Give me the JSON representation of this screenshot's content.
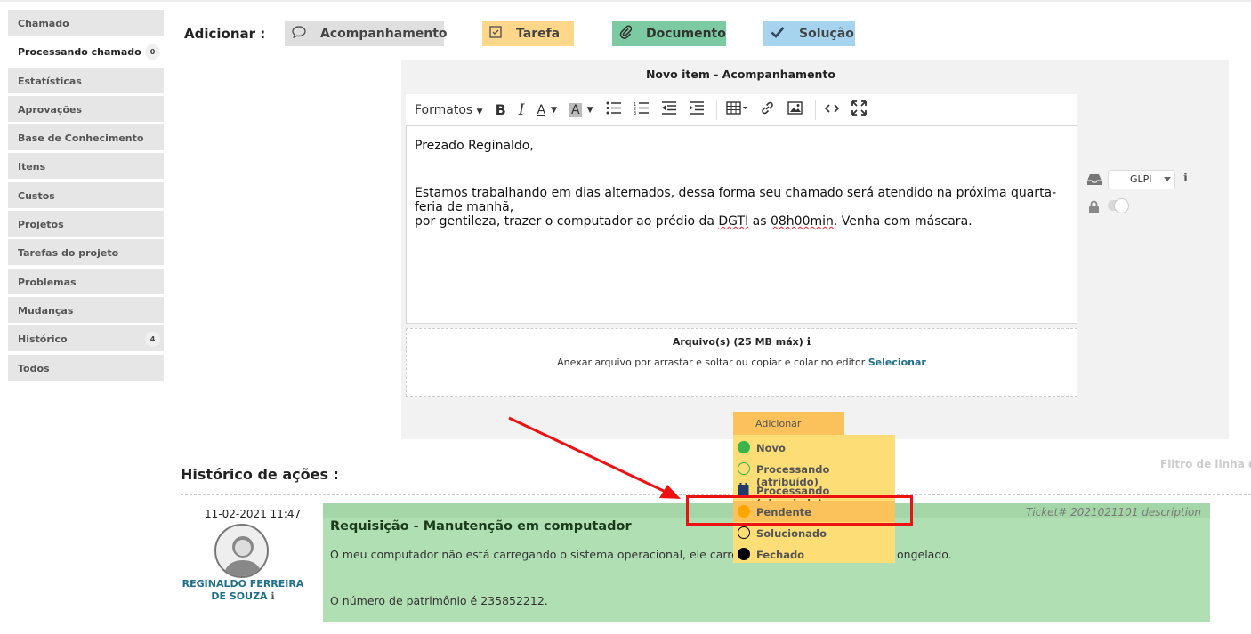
{
  "sidebar": {
    "items": [
      {
        "label": "Chamado"
      },
      {
        "label": "Processando chamado",
        "badge": "0",
        "active": true
      },
      {
        "label": "Estatísticas"
      },
      {
        "label": "Aprovações"
      },
      {
        "label": "Base de Conhecimento"
      },
      {
        "label": "Itens"
      },
      {
        "label": "Custos"
      },
      {
        "label": "Projetos"
      },
      {
        "label": "Tarefas do projeto"
      },
      {
        "label": "Problemas"
      },
      {
        "label": "Mudanças"
      },
      {
        "label": "Histórico",
        "badge": "4"
      },
      {
        "label": "Todos"
      }
    ]
  },
  "addbar": {
    "label": "Adicionar :",
    "acompanhamento": "Acompanhamento",
    "tarefa": "Tarefa",
    "documento": "Documento",
    "solucao": "Solução"
  },
  "editor": {
    "title": "Novo item - Acompanhamento",
    "formatos": "Formatos",
    "greeting": "Prezado Reginaldo,",
    "body_1": "Estamos trabalhando em dias alternados, dessa forma seu chamado será atendido na próxima quarta-feria de manhã,",
    "body_2a": "por gentileza, trazer o computador ao prédio da ",
    "body_2b": "DGTI",
    "body_2c": " as ",
    "body_2d": "08h00min",
    "body_2e": ". Venha com máscara."
  },
  "files": {
    "title": "Arquivo(s) (25 MB máx)",
    "hint": "Anexar arquivo por arrastar e soltar ou copiar e colar no editor ",
    "link": "Selecionar"
  },
  "side_ctrls": {
    "source": "GLPI"
  },
  "dropdown": {
    "header": "Adicionar",
    "options": [
      {
        "label": "Novo",
        "color": "#3cb44b"
      },
      {
        "label": "Processando (atribuído)",
        "color": "#3cb44b"
      },
      {
        "label": "Processando (planejado)",
        "color": "#1f3a6b"
      },
      {
        "label": "Pendente",
        "color": "#ffa500"
      },
      {
        "label": "Solucionado",
        "color": "#000000"
      },
      {
        "label": "Fechado",
        "color": "#000000"
      }
    ]
  },
  "history": {
    "title": "Histórico de ações :",
    "filter": "Filtro de linha d",
    "date": "11-02-2021 11:47",
    "author_1": "REGINALDO FERREIRA",
    "author_2": "DE SOUZA",
    "ticket_id": "Ticket# 2021021101 description",
    "ticket_title": "Requisição - Manutenção em computador",
    "line_1a": "O meu computador não está carregando o sistema operacional, ele carrega",
    "line_1b": "ongelado.",
    "line_2": "O número de patrimônio é 235852212."
  }
}
